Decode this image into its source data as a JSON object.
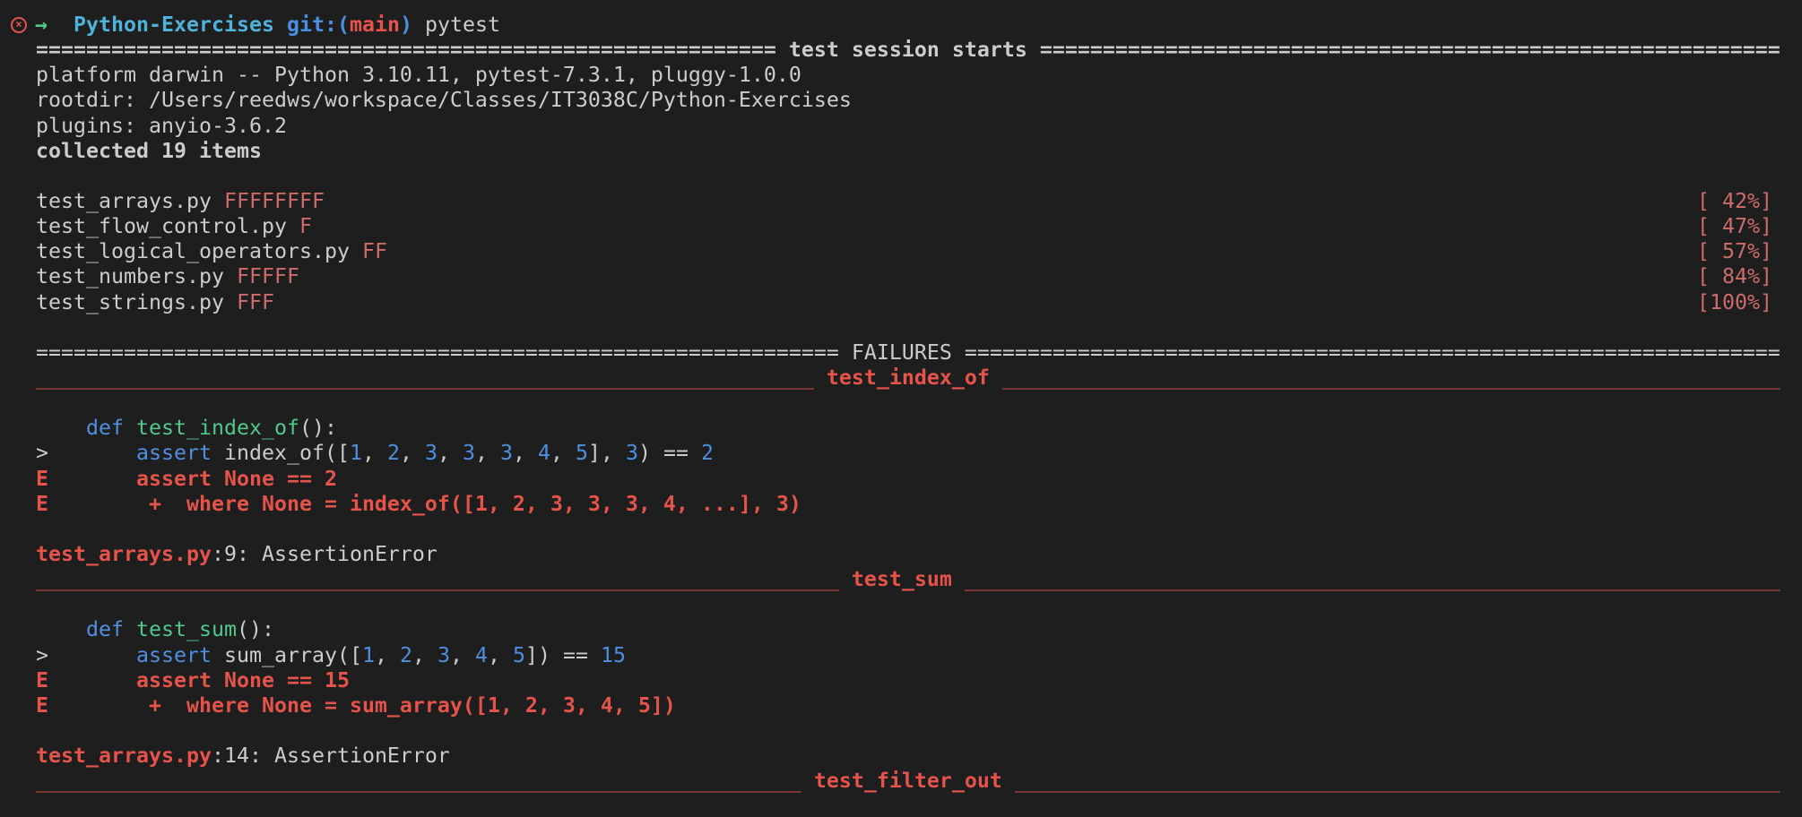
{
  "colors": {
    "background": "#1e1e1e",
    "text": "#cccccc",
    "error_red": "#e5534b",
    "fail_marker": "#cd6b6b",
    "keyword_blue": "#4f8fe0",
    "function_green": "#4ec98a",
    "prompt_dir": "#4fb3d9"
  },
  "prompt": {
    "status_icon": "error-circle-icon",
    "arrow_icon": "arrow-right-icon",
    "directory": "Python-Exercises",
    "git_open": "git:(",
    "branch": "main",
    "git_close": ")",
    "command": " pytest"
  },
  "session": {
    "title": "test session starts",
    "platform": "platform darwin -- Python 3.10.11, pytest-7.3.1, pluggy-1.0.0",
    "rootdir": "rootdir: /Users/reedws/workspace/Classes/IT3038C/Python-Exercises",
    "plugins": "plugins: anyio-3.6.2",
    "collected": "collected 19 items"
  },
  "results": [
    {
      "file": "test_arrays.py",
      "marks": "FFFFFFFF",
      "progress": "[ 42%]"
    },
    {
      "file": "test_flow_control.py",
      "marks": "F",
      "progress": "[ 47%]"
    },
    {
      "file": "test_logical_operators.py",
      "marks": "FF",
      "progress": "[ 57%]"
    },
    {
      "file": "test_numbers.py",
      "marks": "FFFFF",
      "progress": "[ 84%]"
    },
    {
      "file": "test_strings.py",
      "marks": "FFF",
      "progress": "[100%]"
    }
  ],
  "failures_title": "FAILURES",
  "failures": [
    {
      "name": "test_index_of",
      "lines": [
        [
          {
            "t": "    "
          },
          {
            "t": "def",
            "c": "kw"
          },
          {
            "t": " "
          },
          {
            "t": "test_index_of",
            "c": "fn"
          },
          {
            "t": "():"
          }
        ],
        [
          {
            "t": ">       "
          },
          {
            "t": "assert",
            "c": "kw"
          },
          {
            "t": " index_of(["
          },
          {
            "t": "1",
            "c": "num"
          },
          {
            "t": ", "
          },
          {
            "t": "2",
            "c": "num"
          },
          {
            "t": ", "
          },
          {
            "t": "3",
            "c": "num"
          },
          {
            "t": ", "
          },
          {
            "t": "3",
            "c": "num"
          },
          {
            "t": ", "
          },
          {
            "t": "3",
            "c": "num"
          },
          {
            "t": ", "
          },
          {
            "t": "4",
            "c": "num"
          },
          {
            "t": ", "
          },
          {
            "t": "5",
            "c": "num"
          },
          {
            "t": "], "
          },
          {
            "t": "3",
            "c": "num"
          },
          {
            "t": ") == "
          },
          {
            "t": "2",
            "c": "num"
          }
        ],
        [
          {
            "t": "E       assert None == 2",
            "c": "err"
          }
        ],
        [
          {
            "t": "E        +  where None = index_of([1, 2, 3, 3, 3, 4, ...], 3)",
            "c": "err"
          }
        ]
      ],
      "location_file": "test_arrays.py",
      "location_rest": ":9: AssertionError"
    },
    {
      "name": "test_sum",
      "lines": [
        [
          {
            "t": "    "
          },
          {
            "t": "def",
            "c": "kw"
          },
          {
            "t": " "
          },
          {
            "t": "test_sum",
            "c": "fn"
          },
          {
            "t": "():"
          }
        ],
        [
          {
            "t": ">       "
          },
          {
            "t": "assert",
            "c": "kw"
          },
          {
            "t": " sum_array(["
          },
          {
            "t": "1",
            "c": "num"
          },
          {
            "t": ", "
          },
          {
            "t": "2",
            "c": "num"
          },
          {
            "t": ", "
          },
          {
            "t": "3",
            "c": "num"
          },
          {
            "t": ", "
          },
          {
            "t": "4",
            "c": "num"
          },
          {
            "t": ", "
          },
          {
            "t": "5",
            "c": "num"
          },
          {
            "t": "]) == "
          },
          {
            "t": "15",
            "c": "num"
          }
        ],
        [
          {
            "t": "E       assert None == 15",
            "c": "err"
          }
        ],
        [
          {
            "t": "E        +  where None = sum_array([1, 2, 3, 4, 5])",
            "c": "err"
          }
        ]
      ],
      "location_file": "test_arrays.py",
      "location_rest": ":14: AssertionError"
    },
    {
      "name": "test_filter_out",
      "lines": [],
      "location_file": "",
      "location_rest": ""
    }
  ]
}
